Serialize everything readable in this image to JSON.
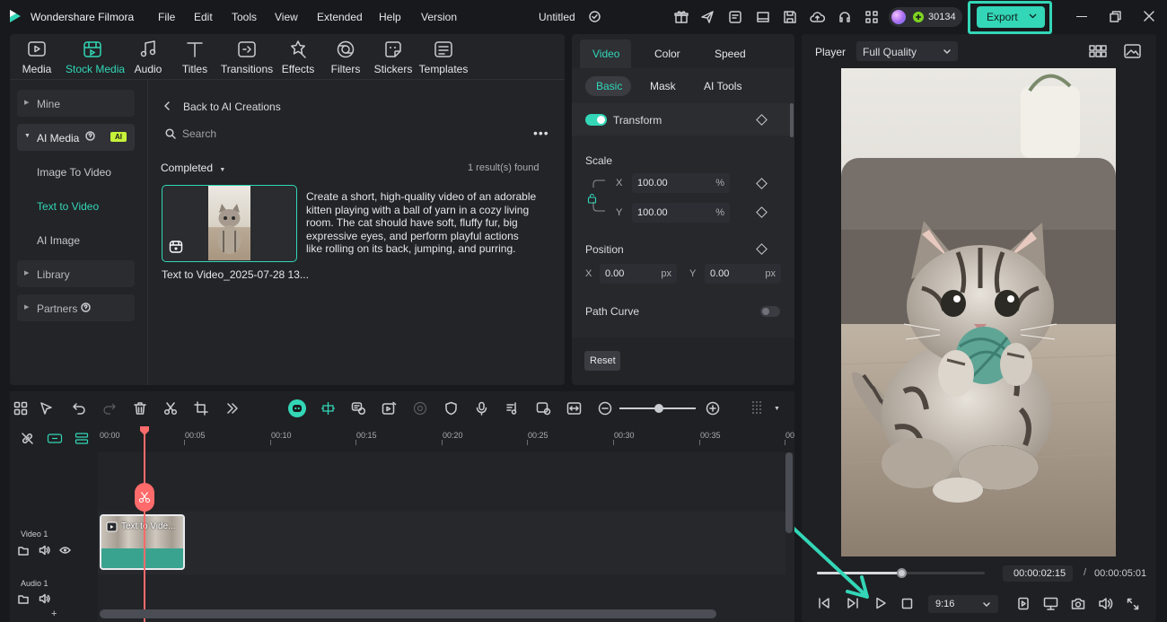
{
  "app": {
    "name": "Wondershare Filmora",
    "project_title": "Untitled"
  },
  "menu": [
    "File",
    "Edit",
    "Tools",
    "View",
    "Extended",
    "Help",
    "Version"
  ],
  "credits": "30134",
  "export_label": "Export",
  "toolbar": [
    {
      "label": "Media",
      "icon": "media-icon"
    },
    {
      "label": "Stock Media",
      "icon": "stock-media-icon"
    },
    {
      "label": "Audio",
      "icon": "audio-icon"
    },
    {
      "label": "Titles",
      "icon": "titles-icon"
    },
    {
      "label": "Transitions",
      "icon": "transitions-icon"
    },
    {
      "label": "Effects",
      "icon": "effects-icon"
    },
    {
      "label": "Filters",
      "icon": "filters-icon"
    },
    {
      "label": "Stickers",
      "icon": "stickers-icon"
    },
    {
      "label": "Templates",
      "icon": "templates-icon"
    }
  ],
  "sidebar": {
    "mine": "Mine",
    "ai_media": "AI Media",
    "ai_badge": "AI",
    "sub": [
      "Image To Video",
      "Text to Video",
      "AI Image"
    ],
    "library": "Library",
    "partners": "Partners"
  },
  "browser": {
    "back": "Back to AI Creations",
    "search_placeholder": "Search",
    "filter": "Completed",
    "result_count": "1 result(s) found",
    "item_name": "Text to Video_2025-07-28 13...",
    "prompt": "Create a short, high-quality video of an adorable kitten playing with a ball of yarn in a cozy living room. The cat should have soft, fluffy fur, big expressive eyes, and perform playful actions like rolling on its back, jumping, and purring."
  },
  "properties": {
    "tabs": [
      "Video",
      "Color",
      "Speed"
    ],
    "subtabs": [
      "Basic",
      "Mask",
      "AI Tools"
    ],
    "transform": "Transform",
    "scale": "Scale",
    "scale_x_label": "X",
    "scale_y_label": "Y",
    "scale_x": "100.00",
    "scale_y": "100.00",
    "percent": "%",
    "position": "Position",
    "pos_x_label": "X",
    "pos_y_label": "Y",
    "pos_x": "0.00",
    "pos_y": "0.00",
    "px": "px",
    "path_curve": "Path Curve",
    "reset": "Reset"
  },
  "player": {
    "label": "Player",
    "quality": "Full Quality",
    "current_time": "00:00:02:15",
    "separator": "/",
    "total_time": "00:00:05:01",
    "aspect": "9:16",
    "progress": 0.5
  },
  "timeline": {
    "ticks": [
      "00:00",
      "00:05",
      "00:10",
      "00:15",
      "00:20",
      "00:25",
      "00:30",
      "00:35",
      "00"
    ],
    "video_track": "Video 1",
    "audio_track": "Audio 1",
    "clip_label": "Text to Vide...",
    "add": "+"
  },
  "colors": {
    "accent": "#33d6b7",
    "playhead": "#ff6b6b",
    "bg": "#18191c",
    "panel": "#222427"
  }
}
